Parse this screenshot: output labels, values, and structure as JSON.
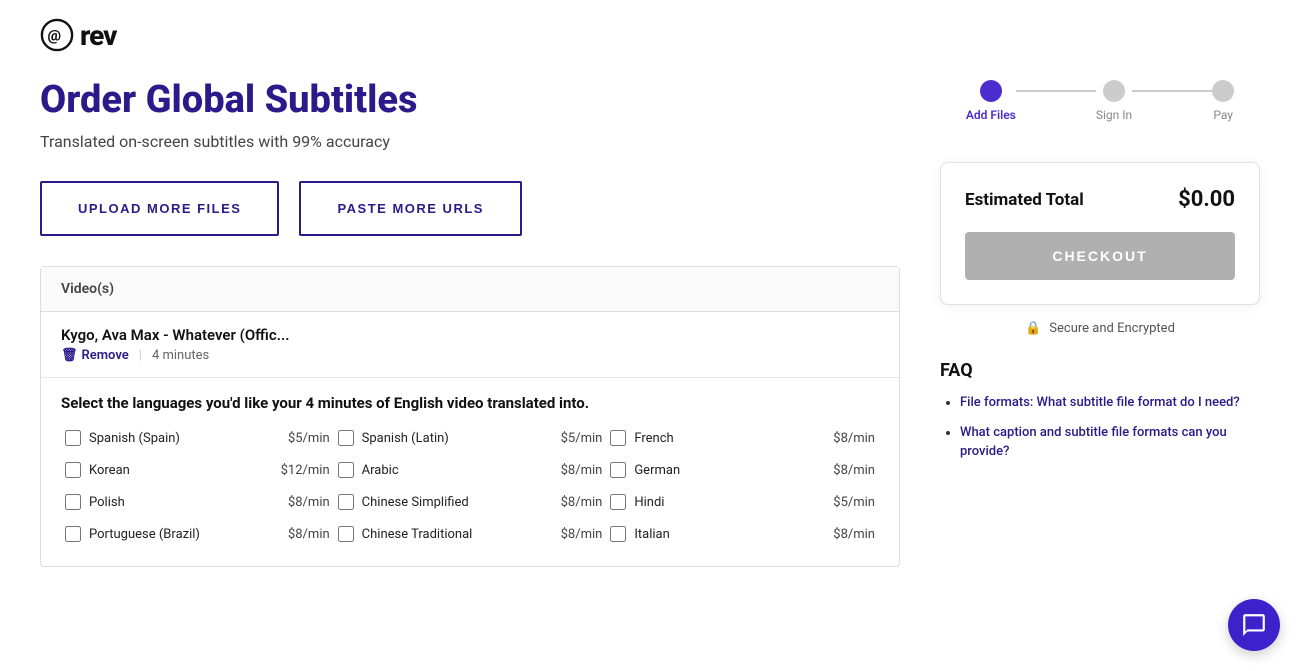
{
  "header": {
    "logo_text": "rev",
    "logo_icon": "at-sign"
  },
  "page": {
    "title": "Order Global Subtitles",
    "subtitle": "Translated on-screen subtitles with 99% accuracy"
  },
  "buttons": {
    "upload_more": "UPLOAD MORE FILES",
    "paste_urls": "PASTE MORE URLS"
  },
  "steps": [
    {
      "label": "Add Files",
      "active": true
    },
    {
      "label": "Sign In",
      "active": false
    },
    {
      "label": "Pay",
      "active": false
    }
  ],
  "table": {
    "header": "Video(s)",
    "video_name": "Kygo, Ava Max - Whatever (Offic...",
    "remove_label": "Remove",
    "duration": "4 minutes",
    "language_prompt": "Select the languages you'd like your 4 minutes of English video translated into.",
    "languages": [
      {
        "name": "Spanish (Spain)",
        "price": "$5/min"
      },
      {
        "name": "Spanish (Latin)",
        "price": "$5/min"
      },
      {
        "name": "French",
        "price": "$8/min"
      },
      {
        "name": "Korean",
        "price": "$12/min"
      },
      {
        "name": "Arabic",
        "price": "$8/min"
      },
      {
        "name": "German",
        "price": "$8/min"
      },
      {
        "name": "Polish",
        "price": "$8/min"
      },
      {
        "name": "Chinese Simplified",
        "price": "$8/min"
      },
      {
        "name": "Hindi",
        "price": "$5/min"
      },
      {
        "name": "Portuguese (Brazil)",
        "price": "$8/min"
      },
      {
        "name": "Chinese Traditional",
        "price": "$8/min"
      },
      {
        "name": "Italian",
        "price": "$8/min"
      }
    ]
  },
  "summary": {
    "estimated_total_label": "Estimated Total",
    "amount": "$0.00",
    "checkout_label": "CHECKOUT",
    "secure_label": "Secure and Encrypted"
  },
  "faq": {
    "title": "FAQ",
    "items": [
      {
        "text": "File formats: What subtitle file format do I need?"
      },
      {
        "text": "What caption and subtitle file formats can you provide?"
      }
    ]
  },
  "chat": {
    "label": "chat-support"
  }
}
